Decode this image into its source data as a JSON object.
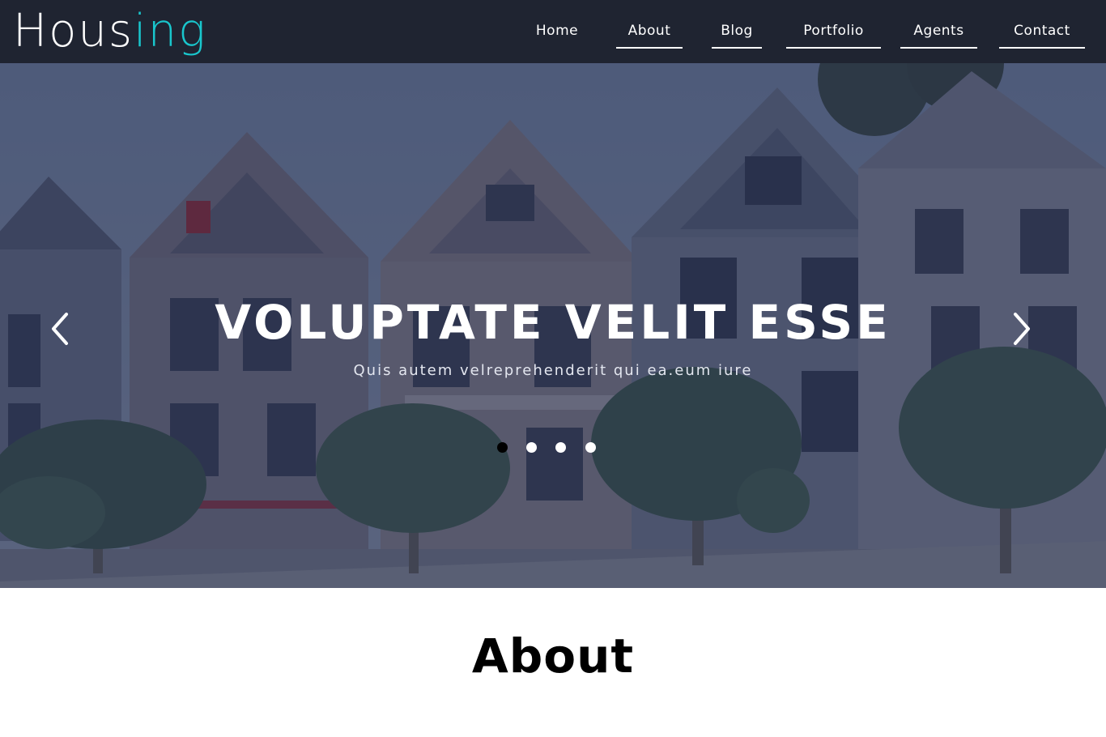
{
  "brand": {
    "logo_main": "Hous",
    "logo_accent": "ing",
    "accent_color": "#19c6cc"
  },
  "nav": {
    "items": [
      {
        "label": "Home"
      },
      {
        "label": "About"
      },
      {
        "label": "Blog"
      },
      {
        "label": "Portfolio"
      },
      {
        "label": "Agents"
      },
      {
        "label": "Contact"
      }
    ],
    "background": "#1f2431"
  },
  "hero": {
    "title": "VOLUPTATE VELIT ESSE",
    "subtitle": "Quis autem velreprehenderit qui ea.eum iure",
    "prev_icon": "chevron-left-icon",
    "next_icon": "chevron-right-icon",
    "slides_count": 4,
    "active_slide": 1
  },
  "about": {
    "heading": "About"
  }
}
